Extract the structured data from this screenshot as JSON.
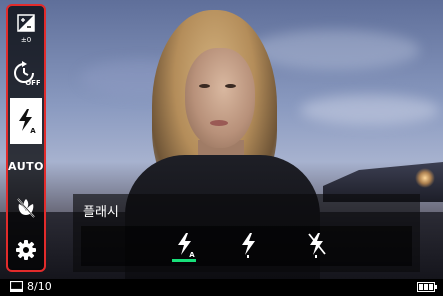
{
  "menu": {
    "items": [
      {
        "name": "exposure-compensation",
        "icon": "exposure-comp-icon",
        "value": "±0"
      },
      {
        "name": "self-timer",
        "icon": "self-timer-off-icon",
        "value": "OFF"
      },
      {
        "name": "flash",
        "icon": "flash-auto-icon",
        "value": "A",
        "selected": true
      },
      {
        "name": "auto",
        "label": "AUTO"
      },
      {
        "name": "macro",
        "icon": "macro-off-icon"
      },
      {
        "name": "settings",
        "icon": "gear-icon"
      }
    ],
    "accent": "#e22b2b"
  },
  "flash_panel": {
    "title": "플래시",
    "options": [
      {
        "icon": "flash-auto-icon",
        "sub": "A",
        "selected": true
      },
      {
        "icon": "flash-on-icon"
      },
      {
        "icon": "flash-off-icon"
      }
    ],
    "selected_color": "#18e07a"
  },
  "status": {
    "counter": "8/10",
    "screen_icon": "display-icon",
    "battery_icon": "battery-full-icon"
  }
}
